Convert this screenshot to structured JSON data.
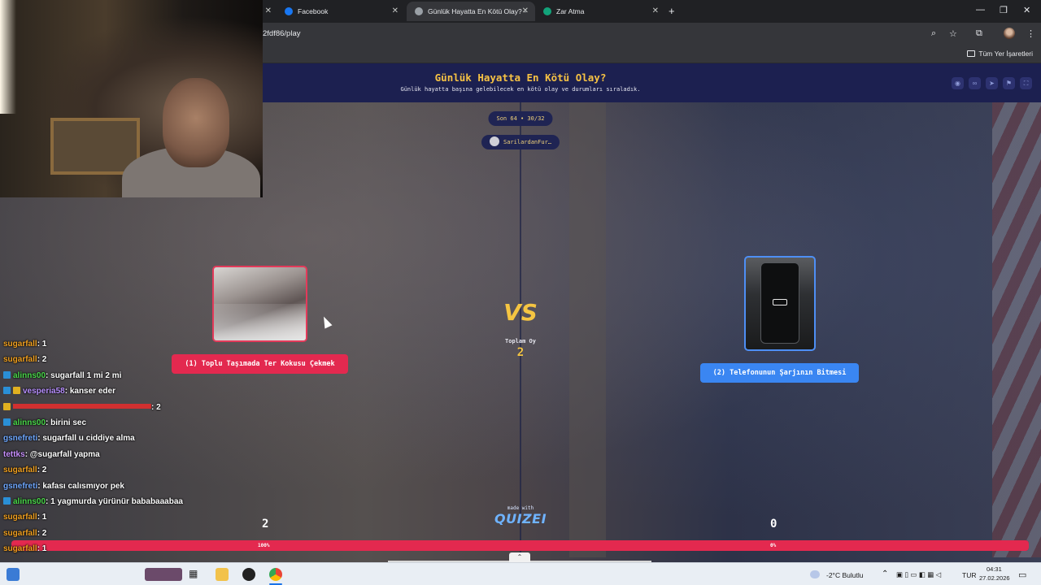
{
  "browser": {
    "tabs": [
      {
        "label": "Facebook",
        "active": false,
        "icon": "facebook-icon"
      },
      {
        "label": "Günlük Hayatta En Kötü Olay? -",
        "active": true,
        "icon": "quizei-icon"
      },
      {
        "label": "Zar Atma",
        "active": false,
        "icon": "zar-atma-icon"
      }
    ],
    "url": "2fdf86/play",
    "bookmarks_label": "Tüm Yer İşaretleri"
  },
  "quiz": {
    "title": "Günlük Hayatta En Kötü Olay?",
    "subtitle": "Günlük hayatta başına gelebilecek en kötü olay ve durumları sıraladık.",
    "round": "Son 64 • 30/32",
    "author": "SarilardanFur…",
    "vs_label": "VS",
    "total_label": "Toplam Oy",
    "total_value": "2",
    "made_with": "made with",
    "brand": "QUIZEI",
    "left": {
      "label": "(1) Toplu Taşımada Ter Kokusu Çekmek",
      "votes": "2",
      "percent": "100%",
      "percent_value": 100
    },
    "right": {
      "label": "(2) Telefonunun Şarjının Bitmesi",
      "votes": "0",
      "percent": "0%",
      "percent_value": 0
    }
  },
  "chat": [
    {
      "user": "sugarfall",
      "text": ": 1",
      "color": "#f0a020",
      "badges": []
    },
    {
      "user": "sugarfall",
      "text": ": 2",
      "color": "#f0a020",
      "badges": []
    },
    {
      "user": "alinns00",
      "text": ": sugarfall 1 mi 2 mi",
      "color": "#4ad94a",
      "badges": [
        "blue"
      ]
    },
    {
      "user": "vesperia58",
      "text": ": kanser eder",
      "color": "#b890ff",
      "badges": [
        "blue",
        "gold"
      ]
    },
    {
      "user": "",
      "text": ": 2",
      "color": "#d03030",
      "badges": [
        "gold"
      ]
    },
    {
      "user": "alinns00",
      "text": ": birini sec",
      "color": "#4ad94a",
      "badges": [
        "blue"
      ]
    },
    {
      "user": "gsnefreti",
      "text": ": sugarfall u ciddiye alma",
      "color": "#6fa8ff",
      "badges": []
    },
    {
      "user": "tettks",
      "text": ": @sugarfall yapma",
      "color": "#c890ff",
      "badges": []
    },
    {
      "user": "sugarfall",
      "text": ": 2",
      "color": "#f0a020",
      "badges": []
    },
    {
      "user": "gsnefreti",
      "text": ": kafası calısmıyor pek",
      "color": "#6fa8ff",
      "badges": []
    },
    {
      "user": "alinns00",
      "text": ": 1 yagmurda yürünür bababaaabaa",
      "color": "#4ad94a",
      "badges": [
        "blue"
      ]
    },
    {
      "user": "sugarfall",
      "text": ": 1",
      "color": "#f0a020",
      "badges": []
    },
    {
      "user": "sugarfall",
      "text": ": 2",
      "color": "#f0a020",
      "badges": []
    },
    {
      "user": "sugarfall",
      "text": ": 1",
      "color": "#f0a020",
      "badges": []
    }
  ],
  "taskbar": {
    "weather": "-2°C  Bulutlu",
    "lang": "TUR",
    "time": "04:31",
    "date": "27.02.2026"
  },
  "colors": {
    "header_bg": "#1c2050",
    "title": "#f6c244",
    "left_accent": "#e3294f",
    "right_accent": "#3a86f2"
  }
}
